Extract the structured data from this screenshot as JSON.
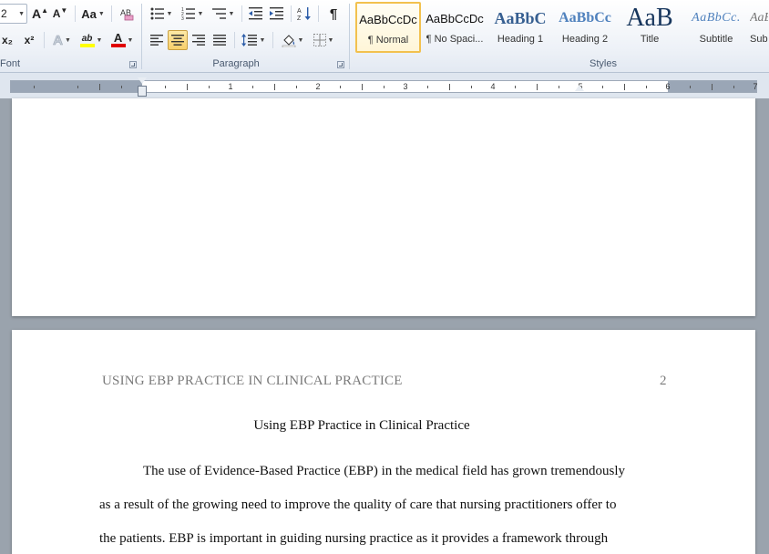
{
  "ribbon": {
    "font_group": {
      "label": "Font",
      "size_value": "2",
      "grow_label": "A",
      "shrink_label": "A",
      "change_case_label": "Aa",
      "subscript_label": "x₂",
      "superscript_label": "x²",
      "text_effects_label": "A",
      "highlight_label": "ab",
      "font_color_label": "A",
      "highlight_color": "#ffff00",
      "font_color": "#e00000"
    },
    "paragraph_group": {
      "label": "Paragraph",
      "show_marks_label": "¶"
    },
    "styles_group": {
      "label": "Styles",
      "styles": [
        {
          "preview": "AaBbCcDc",
          "name": "¶ Normal"
        },
        {
          "preview": "AaBbCcDc",
          "name": "¶ No Spaci..."
        },
        {
          "preview": "AaBbC",
          "name": "Heading 1"
        },
        {
          "preview": "AaBbCc",
          "name": "Heading 2"
        },
        {
          "preview": "AaB",
          "name": "Title"
        },
        {
          "preview": "AaBbCc.",
          "name": "Subtitle"
        },
        {
          "preview": "AaBbCc",
          "name": "Sub"
        }
      ]
    }
  },
  "ruler": {
    "numbers": [
      "1",
      "2",
      "3",
      "4",
      "5",
      "6",
      "7"
    ]
  },
  "document": {
    "header_text": "USING EBP PRACTICE IN CLINICAL PRACTICE",
    "page_number": "2",
    "title": "Using EBP Practice in Clinical Practice",
    "paragraph_lines": [
      "The use of Evidence-Based Practice (EBP) in the medical field has grown tremendously",
      "as a result of the growing need to improve the quality of care that nursing practitioners offer to",
      "the patients. EBP is important in guiding nursing practice as it provides a framework through"
    ]
  },
  "colors": {
    "accent_selected_style": "#f2c14e",
    "heading_blue": "#365f91",
    "title_navy": "#17365d"
  }
}
